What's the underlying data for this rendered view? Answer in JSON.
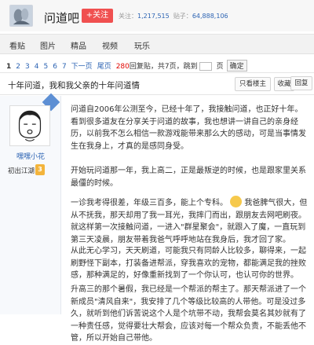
{
  "header": {
    "forum_title": "问道吧",
    "follow_label": "+关注",
    "stats": {
      "follow_label": "关注：",
      "follow_count": "1,217,515",
      "posts_label": "贴子：",
      "posts_count": "64,888,106"
    }
  },
  "nav": {
    "items": [
      "看贴",
      "图片",
      "精品",
      "视频",
      "玩乐"
    ]
  },
  "pager": {
    "pages": [
      "1",
      "2",
      "3",
      "4",
      "5",
      "6",
      "7"
    ],
    "next": "下一页",
    "last": "尾页",
    "reply_count": "280",
    "reply_text": "回复贴，共",
    "page_count": "7",
    "page_text": "页，跳到",
    "page_unit": "页",
    "confirm": "确定"
  },
  "thread": {
    "title": "十年问道，我和我父亲的十年问道情",
    "only_author": "只看楼主",
    "favorite": "收藏",
    "reply": "回复"
  },
  "author": {
    "name": "嘿嘿小花",
    "level_name": "初出江湖",
    "level": "3"
  },
  "post": {
    "paragraphs": [
      "问道自2006年公测至今，已经十年了，我接触问道，也正好十年。看到很多道友在分享关于问道的故事，我也想讲一讲自己的亲身经历，以前我不怎么相信一款游戏能带来那么大的感动，可是当事情发生在我身上，才真的是感同身受。",
      "开始玩问道那一年，我上高二，正是最叛逆的时候，也是跟家里关系最僵的时候。",
      "一诊我考得很差，年级三百多，能上个专科。",
      "我爸脾气很大，但从不抚我，那天却用了我一耳光，我摔门而出，跟朋友去网吧刷夜。就这样第一次接触问道，一进入\"群星聚会\"，就跟入了魔，一直玩到第三天凌晨，朋友带着我爸气呼呼地站在我身后，我才回了家。",
      "从此无心学习，天天刷道，可能我只有同龄人比较多，聊得来，一起刷野怪下副本，打装备进帮派，穿我喜欢的宠物，都能满足我的挫败感，那种满足的，好像重新找到了一个你认可，也认可你的世界。",
      "升高三的那个暑假，我已经是一个帮派的帮主了。那天帮派进了一个新成员\"清风自来\"，我安排了几个等级比较高的人带他。可是没过多久，就听到他们诉苦说这个人是个坑带不动，我帮会莫名其妙就有了一种责任感，觉得要壮大帮会，应该对每一个帮众负责，不能丢他不管，所以开始自己带他。"
    ]
  }
}
